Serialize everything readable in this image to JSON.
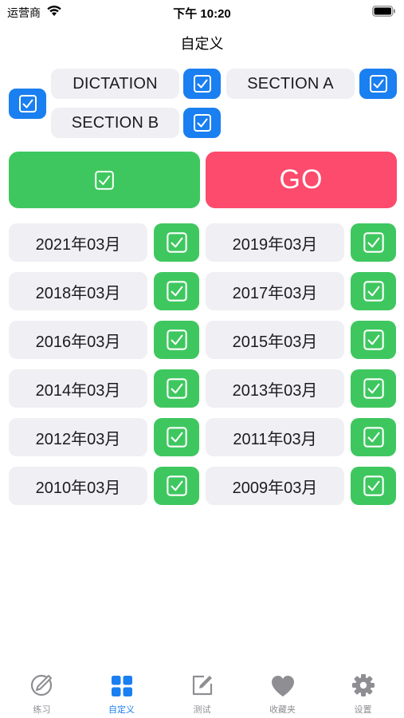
{
  "status_bar": {
    "carrier": "运营商",
    "time": "下午 10:20"
  },
  "nav": {
    "title": "自定义"
  },
  "sections": [
    {
      "label": "DICTATION",
      "checked": true
    },
    {
      "label": "SECTION A",
      "checked": true
    },
    {
      "label": "SECTION B",
      "checked": true
    }
  ],
  "actions": {
    "go_label": "GO"
  },
  "years": [
    {
      "label": "2021年03月",
      "checked": true
    },
    {
      "label": "2019年03月",
      "checked": true
    },
    {
      "label": "2018年03月",
      "checked": true
    },
    {
      "label": "2017年03月",
      "checked": true
    },
    {
      "label": "2016年03月",
      "checked": true
    },
    {
      "label": "2015年03月",
      "checked": true
    },
    {
      "label": "2014年03月",
      "checked": true
    },
    {
      "label": "2013年03月",
      "checked": true
    },
    {
      "label": "2012年03月",
      "checked": true
    },
    {
      "label": "2011年03月",
      "checked": true
    },
    {
      "label": "2010年03月",
      "checked": true
    },
    {
      "label": "2009年03月",
      "checked": true
    }
  ],
  "tabs": [
    {
      "label": "练习",
      "icon": "pencil-circle-icon",
      "active": false
    },
    {
      "label": "自定义",
      "icon": "grid-icon",
      "active": true
    },
    {
      "label": "测试",
      "icon": "edit-square-icon",
      "active": false
    },
    {
      "label": "收藏夹",
      "icon": "heart-icon",
      "active": false
    },
    {
      "label": "设置",
      "icon": "gear-icon",
      "active": false
    }
  ],
  "colors": {
    "blue": "#1a7ff0",
    "green": "#3fc75f",
    "red": "#fc4b6c",
    "pill_bg": "#efeff4",
    "tab_inactive": "#8e8e93"
  }
}
